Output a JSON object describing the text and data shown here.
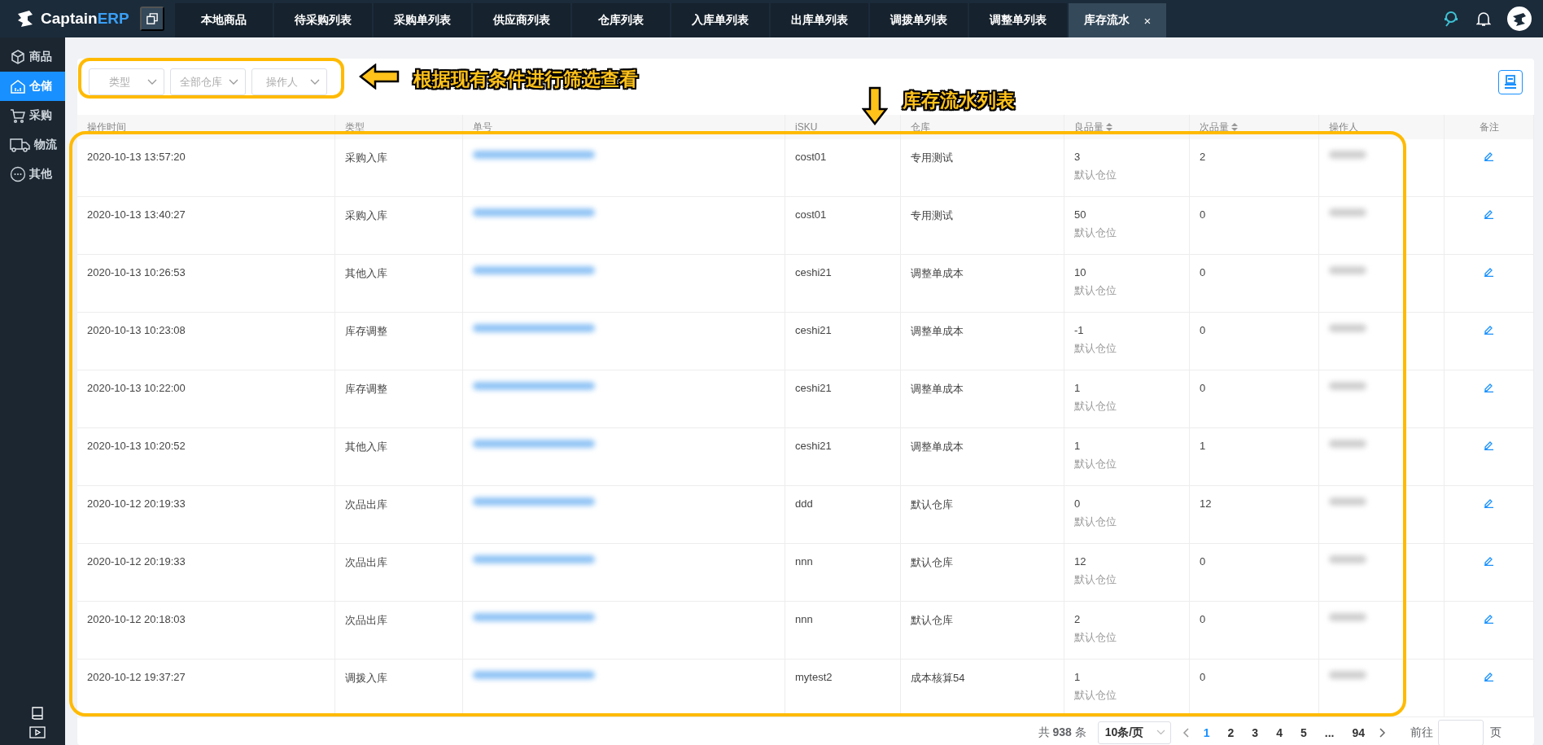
{
  "logo": {
    "name": "Captain",
    "accent": "ERP"
  },
  "tabs": [
    {
      "label": "本地商品",
      "selected": false
    },
    {
      "label": "待采购列表",
      "selected": false
    },
    {
      "label": "采购单列表",
      "selected": false
    },
    {
      "label": "供应商列表",
      "selected": false
    },
    {
      "label": "仓库列表",
      "selected": false
    },
    {
      "label": "入库单列表",
      "selected": false
    },
    {
      "label": "出库单列表",
      "selected": false
    },
    {
      "label": "调拨单列表",
      "selected": false
    },
    {
      "label": "调整单列表",
      "selected": false
    },
    {
      "label": "库存流水",
      "selected": true,
      "close": "×"
    }
  ],
  "sidebar": {
    "items": [
      {
        "label": "商品",
        "selected": false
      },
      {
        "label": "仓储",
        "selected": true
      },
      {
        "label": "采购",
        "selected": false
      },
      {
        "label": "物流",
        "selected": false
      },
      {
        "label": "其他",
        "selected": false
      }
    ]
  },
  "filters": [
    {
      "placeholder": "类型"
    },
    {
      "placeholder": "全部仓库"
    },
    {
      "placeholder": "操作人"
    }
  ],
  "annotations": {
    "filter_note": "根据现有条件进行筛选查看",
    "table_note": "库存流水列表"
  },
  "table": {
    "columns": [
      {
        "label": "操作时间",
        "sortable": false
      },
      {
        "label": "类型",
        "sortable": false
      },
      {
        "label": "单号",
        "sortable": false
      },
      {
        "label": "iSKU",
        "sortable": false
      },
      {
        "label": "仓库",
        "sortable": false
      },
      {
        "label": "良品量",
        "sortable": true
      },
      {
        "label": "次品量",
        "sortable": true
      },
      {
        "label": "操作人",
        "sortable": false
      },
      {
        "label": "备注",
        "sortable": false
      }
    ],
    "rows": [
      {
        "time": "2020-10-13 13:57:20",
        "type": "采购入库",
        "isku": "cost01",
        "warehouse": "专用测试",
        "good_qty": "3",
        "location": "默认仓位",
        "defect_qty": "2"
      },
      {
        "time": "2020-10-13 13:40:27",
        "type": "采购入库",
        "isku": "cost01",
        "warehouse": "专用测试",
        "good_qty": "50",
        "location": "默认仓位",
        "defect_qty": "0"
      },
      {
        "time": "2020-10-13 10:26:53",
        "type": "其他入库",
        "isku": "ceshi21",
        "warehouse": "调整单成本",
        "good_qty": "10",
        "location": "默认仓位",
        "defect_qty": "0"
      },
      {
        "time": "2020-10-13 10:23:08",
        "type": "库存调整",
        "isku": "ceshi21",
        "warehouse": "调整单成本",
        "good_qty": "-1",
        "location": "默认仓位",
        "defect_qty": "0"
      },
      {
        "time": "2020-10-13 10:22:00",
        "type": "库存调整",
        "isku": "ceshi21",
        "warehouse": "调整单成本",
        "good_qty": "1",
        "location": "默认仓位",
        "defect_qty": "0"
      },
      {
        "time": "2020-10-13 10:20:52",
        "type": "其他入库",
        "isku": "ceshi21",
        "warehouse": "调整单成本",
        "good_qty": "1",
        "location": "默认仓位",
        "defect_qty": "1"
      },
      {
        "time": "2020-10-12 20:19:33",
        "type": "次品出库",
        "isku": "ddd",
        "warehouse": "默认仓库",
        "good_qty": "0",
        "location": "默认仓位",
        "defect_qty": "12"
      },
      {
        "time": "2020-10-12 20:19:33",
        "type": "次品出库",
        "isku": "nnn",
        "warehouse": "默认仓库",
        "good_qty": "12",
        "location": "默认仓位",
        "defect_qty": "0"
      },
      {
        "time": "2020-10-12 20:18:03",
        "type": "次品出库",
        "isku": "nnn",
        "warehouse": "默认仓库",
        "good_qty": "2",
        "location": "默认仓位",
        "defect_qty": "0"
      },
      {
        "time": "2020-10-12 19:37:27",
        "type": "调拨入库",
        "isku": "mytest2",
        "warehouse": "成本核算54",
        "good_qty": "1",
        "location": "默认仓位",
        "defect_qty": "0"
      }
    ]
  },
  "pagination": {
    "total_prefix": "共",
    "total": "938",
    "total_suffix": "条",
    "page_size": "10条/页",
    "pages": [
      {
        "label": "1",
        "selected": true
      },
      {
        "label": "2",
        "selected": false
      },
      {
        "label": "3",
        "selected": false
      },
      {
        "label": "4",
        "selected": false
      },
      {
        "label": "5",
        "selected": false
      },
      {
        "label": "...",
        "selected": false
      },
      {
        "label": "94",
        "selected": false
      }
    ],
    "goto_prefix": "前往",
    "goto_suffix": "页"
  }
}
